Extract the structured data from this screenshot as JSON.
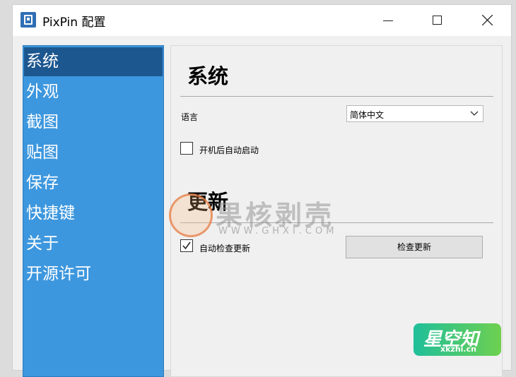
{
  "window": {
    "title": "PixPin 配置"
  },
  "sidebar": {
    "items": [
      {
        "label": "系统",
        "active": true
      },
      {
        "label": "外观"
      },
      {
        "label": "截图"
      },
      {
        "label": "贴图"
      },
      {
        "label": "保存"
      },
      {
        "label": "快捷键"
      },
      {
        "label": "关于"
      },
      {
        "label": "开源许可"
      }
    ]
  },
  "system_section": {
    "title": "系统",
    "language_label": "语言",
    "language_value": "简体中文",
    "autostart_label": "开机后自动启动",
    "autostart_checked": false
  },
  "update_section": {
    "title": "更新",
    "auto_check_label": "自动检查更新",
    "auto_check_checked": true,
    "check_button_label": "检查更新"
  },
  "watermark": {
    "text": "果核剥壳",
    "url": "WWW.GHXI.COM"
  },
  "corner_logo": {
    "main": "星空知",
    "sub": "xkzhi.cn"
  },
  "colors": {
    "sidebar_bg": "#3d97de",
    "sidebar_active": "#1d578f",
    "window_bg": "#f0f0f0"
  }
}
